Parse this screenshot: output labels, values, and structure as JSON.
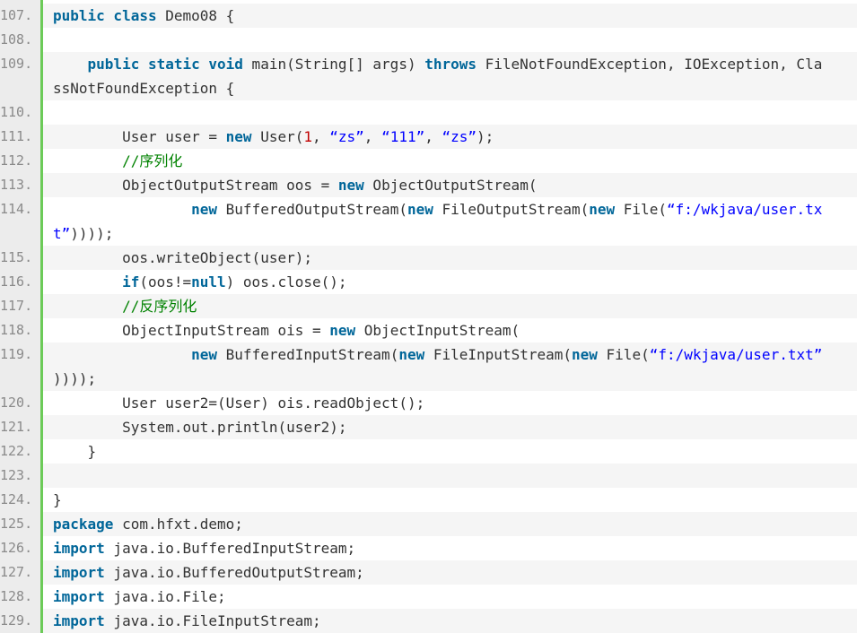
{
  "code_lines": [
    {
      "n": "107.",
      "alt": true,
      "parts": [
        {
          "t": "kw",
          "v": "public class"
        },
        {
          "t": "plain",
          "v": " Demo08 {"
        }
      ]
    },
    {
      "n": "108.",
      "alt": false,
      "parts": []
    },
    {
      "n": "109.",
      "alt": true,
      "parts": [
        {
          "t": "plain",
          "v": "    "
        },
        {
          "t": "kw",
          "v": "public static void"
        },
        {
          "t": "plain",
          "v": " main(String[] args) "
        },
        {
          "t": "kw",
          "v": "throws"
        },
        {
          "t": "plain",
          "v": " FileNotFoundException, IOException, Cla"
        }
      ]
    },
    {
      "n": "",
      "alt": true,
      "parts": [
        {
          "t": "plain",
          "v": "ssNotFoundException {"
        }
      ]
    },
    {
      "n": "110.",
      "alt": false,
      "parts": []
    },
    {
      "n": "111.",
      "alt": true,
      "parts": [
        {
          "t": "plain",
          "v": "        User user = "
        },
        {
          "t": "kw",
          "v": "new"
        },
        {
          "t": "plain",
          "v": " User("
        },
        {
          "t": "num",
          "v": "1"
        },
        {
          "t": "plain",
          "v": ", "
        },
        {
          "t": "str",
          "v": "“zs”"
        },
        {
          "t": "plain",
          "v": ", "
        },
        {
          "t": "str",
          "v": "“111”"
        },
        {
          "t": "plain",
          "v": ", "
        },
        {
          "t": "str",
          "v": "“zs”"
        },
        {
          "t": "plain",
          "v": ");"
        }
      ]
    },
    {
      "n": "112.",
      "alt": false,
      "parts": [
        {
          "t": "plain",
          "v": "        "
        },
        {
          "t": "cmt",
          "v": "//序列化"
        }
      ]
    },
    {
      "n": "113.",
      "alt": true,
      "parts": [
        {
          "t": "plain",
          "v": "        ObjectOutputStream oos = "
        },
        {
          "t": "kw",
          "v": "new"
        },
        {
          "t": "plain",
          "v": " ObjectOutputStream("
        }
      ]
    },
    {
      "n": "114.",
      "alt": false,
      "parts": [
        {
          "t": "plain",
          "v": "                "
        },
        {
          "t": "kw",
          "v": "new"
        },
        {
          "t": "plain",
          "v": " BufferedOutputStream("
        },
        {
          "t": "kw",
          "v": "new"
        },
        {
          "t": "plain",
          "v": " FileOutputStream("
        },
        {
          "t": "kw",
          "v": "new"
        },
        {
          "t": "plain",
          "v": " File("
        },
        {
          "t": "str",
          "v": "“f:/wkjava/user.tx"
        }
      ]
    },
    {
      "n": "",
      "alt": false,
      "parts": [
        {
          "t": "str",
          "v": "t”"
        },
        {
          "t": "plain",
          "v": "))));"
        }
      ]
    },
    {
      "n": "115.",
      "alt": true,
      "parts": [
        {
          "t": "plain",
          "v": "        oos.writeObject(user);"
        }
      ]
    },
    {
      "n": "116.",
      "alt": false,
      "parts": [
        {
          "t": "plain",
          "v": "        "
        },
        {
          "t": "kw",
          "v": "if"
        },
        {
          "t": "plain",
          "v": "(oos!="
        },
        {
          "t": "kw",
          "v": "null"
        },
        {
          "t": "plain",
          "v": ") oos.close();"
        }
      ]
    },
    {
      "n": "117.",
      "alt": true,
      "parts": [
        {
          "t": "plain",
          "v": "        "
        },
        {
          "t": "cmt",
          "v": "//反序列化"
        }
      ]
    },
    {
      "n": "118.",
      "alt": false,
      "parts": [
        {
          "t": "plain",
          "v": "        ObjectInputStream ois = "
        },
        {
          "t": "kw",
          "v": "new"
        },
        {
          "t": "plain",
          "v": " ObjectInputStream("
        }
      ]
    },
    {
      "n": "119.",
      "alt": true,
      "parts": [
        {
          "t": "plain",
          "v": "                "
        },
        {
          "t": "kw",
          "v": "new"
        },
        {
          "t": "plain",
          "v": " BufferedInputStream("
        },
        {
          "t": "kw",
          "v": "new"
        },
        {
          "t": "plain",
          "v": " FileInputStream("
        },
        {
          "t": "kw",
          "v": "new"
        },
        {
          "t": "plain",
          "v": " File("
        },
        {
          "t": "str",
          "v": "“f:/wkjava/user.txt”"
        }
      ]
    },
    {
      "n": "",
      "alt": true,
      "parts": [
        {
          "t": "plain",
          "v": "))));"
        }
      ]
    },
    {
      "n": "120.",
      "alt": false,
      "parts": [
        {
          "t": "plain",
          "v": "        User user2=(User) ois.readObject();"
        }
      ]
    },
    {
      "n": "121.",
      "alt": true,
      "parts": [
        {
          "t": "plain",
          "v": "        System.out.println(user2);"
        }
      ]
    },
    {
      "n": "122.",
      "alt": false,
      "parts": [
        {
          "t": "plain",
          "v": "    }"
        }
      ]
    },
    {
      "n": "123.",
      "alt": true,
      "parts": []
    },
    {
      "n": "124.",
      "alt": false,
      "parts": [
        {
          "t": "plain",
          "v": "}"
        }
      ]
    },
    {
      "n": "125.",
      "alt": true,
      "parts": [
        {
          "t": "kw",
          "v": "package"
        },
        {
          "t": "plain",
          "v": " com.hfxt.demo;"
        }
      ]
    },
    {
      "n": "126.",
      "alt": false,
      "parts": [
        {
          "t": "kw",
          "v": "import"
        },
        {
          "t": "plain",
          "v": " java.io.BufferedInputStream;"
        }
      ]
    },
    {
      "n": "127.",
      "alt": true,
      "parts": [
        {
          "t": "kw",
          "v": "import"
        },
        {
          "t": "plain",
          "v": " java.io.BufferedOutputStream;"
        }
      ]
    },
    {
      "n": "128.",
      "alt": false,
      "parts": [
        {
          "t": "kw",
          "v": "import"
        },
        {
          "t": "plain",
          "v": " java.io.File;"
        }
      ]
    },
    {
      "n": "129.",
      "alt": true,
      "parts": [
        {
          "t": "kw",
          "v": "import"
        },
        {
          "t": "plain",
          "v": " java.io.FileInputStream;"
        }
      ]
    }
  ],
  "colors": {
    "keyword": "#006699",
    "string": "#0000ff",
    "number": "#c00000",
    "comment": "#008200",
    "gutter_border": "#6ccb58"
  }
}
